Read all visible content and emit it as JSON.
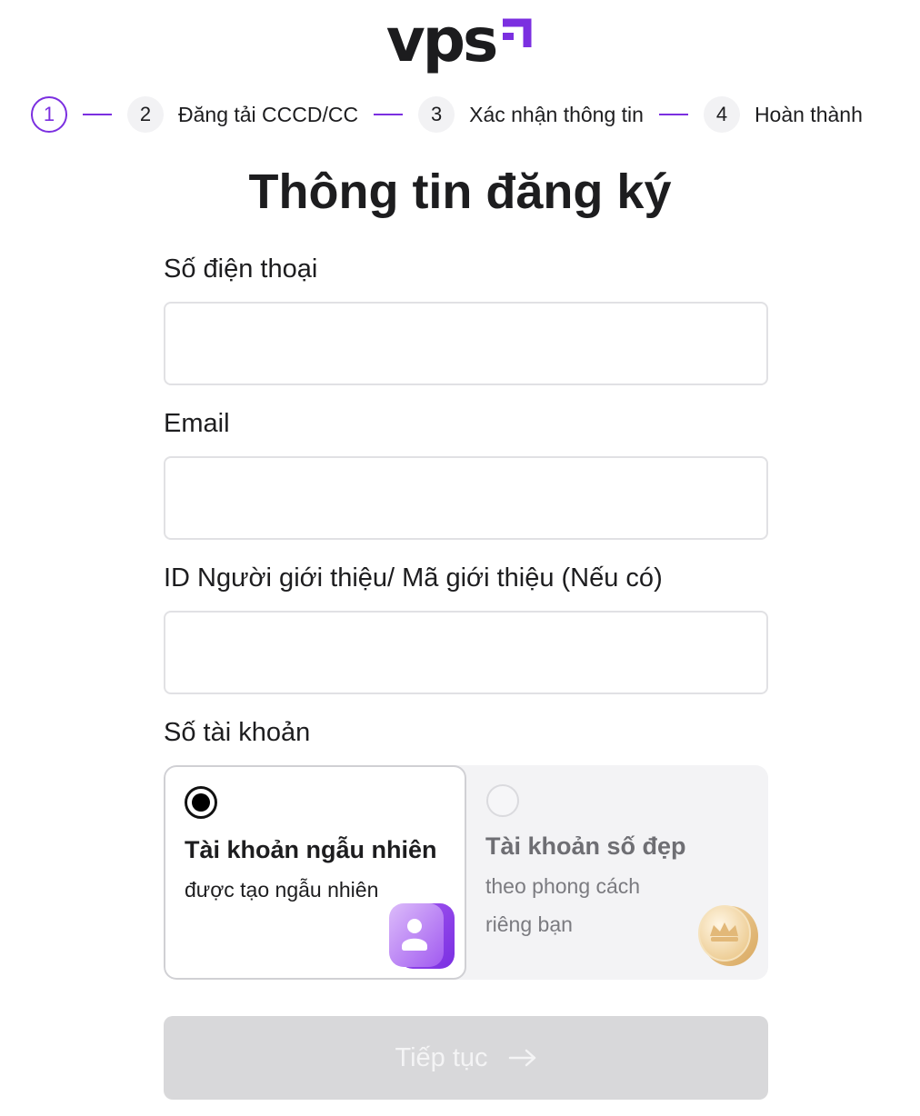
{
  "brand": {
    "logo_text": "vps",
    "accent": "#7b2fe0"
  },
  "stepper": {
    "steps": [
      {
        "number": "1",
        "label": "",
        "state": "active"
      },
      {
        "number": "2",
        "label": "Đăng tải CCCD/CC",
        "state": "pending"
      },
      {
        "number": "3",
        "label": "Xác nhận thông tin",
        "state": "pending"
      },
      {
        "number": "4",
        "label": "Hoàn thành",
        "state": "pending"
      }
    ]
  },
  "page": {
    "title": "Thông tin đăng ký"
  },
  "form": {
    "phone": {
      "label": "Số điện thoại",
      "value": "",
      "placeholder": ""
    },
    "email": {
      "label": "Email",
      "value": "",
      "placeholder": ""
    },
    "referral": {
      "label": "ID Người giới thiệu/ Mã giới thiệu (Nếu có)",
      "value": "",
      "placeholder": ""
    },
    "account": {
      "label": "Số tài khoản",
      "options": [
        {
          "title": "Tài khoản ngẫu nhiên",
          "description": "được tạo ngẫu nhiên",
          "selected": true,
          "icon": "user-badge-icon"
        },
        {
          "title": "Tài khoản số đẹp",
          "description": "theo phong cách riêng bạn",
          "selected": false,
          "icon": "crown-coin-icon"
        }
      ]
    },
    "submit": {
      "label": "Tiếp tục",
      "enabled": false,
      "icon": "arrow-right-icon"
    }
  }
}
